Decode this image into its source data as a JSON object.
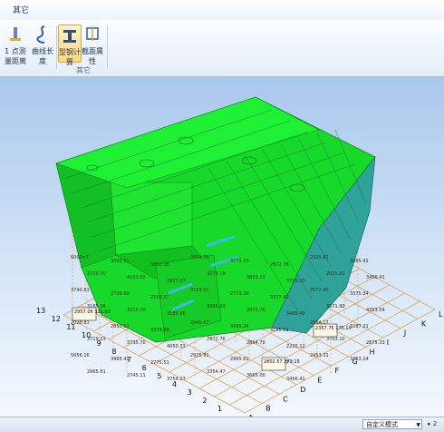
{
  "menubar": {
    "items": [
      "其它"
    ]
  },
  "ribbon": {
    "buttons": [
      {
        "label": "1 点测量距离",
        "icon": "measure-icon"
      },
      {
        "label": "曲线长度",
        "icon": "curve-length-icon"
      },
      {
        "label": "型钢计算",
        "icon": "profile-calc-icon",
        "active": true
      },
      {
        "label": "截面属性",
        "icon": "section-property-icon"
      }
    ],
    "group_label": "其它"
  },
  "viewport": {
    "grid_numbers": [
      "13",
      "12",
      "11",
      "10",
      "9",
      "8",
      "7",
      "6",
      "5",
      "4",
      "3",
      "2",
      "1"
    ],
    "grid_letters": [
      "A",
      "B",
      "C",
      "D",
      "E",
      "F",
      "G",
      "H",
      "I",
      "J",
      "K",
      "L"
    ],
    "dimension_labels": [
      "6090×7",
      "3095.51",
      "3850.28",
      "2972.76",
      "3771.23",
      "2972.76",
      "2025.81",
      "3465.41",
      "3725.70",
      "4153.51",
      "2857.07",
      "3279.19",
      "3819.23",
      "3719.23",
      "2025.81",
      "3456.41",
      "3740.61",
      "2720.69",
      "2150.57",
      "4153.51",
      "2772.30",
      "3377.45",
      "2572.40",
      "3375.34",
      "3185.56",
      "3215.70",
      "3185.56",
      "3365.24",
      "2972.76",
      "3465.40",
      "3571.90",
      "4353.54",
      "2025.81",
      "2850.57",
      "3378.89",
      "2940.67",
      "3455.24",
      "3195.51",
      "2954.17",
      "3287.21",
      "3719.23",
      "3735.70",
      "4050.33",
      "2972.76",
      "2854.70",
      "2225.12",
      "3703.10",
      "2875.33",
      "5656.16",
      "3465.41",
      "2775.51",
      "2925.81",
      "2965.61",
      "3895.97",
      "2453.31",
      "3753.24",
      "2965.61",
      "2745.11",
      "3754.27",
      "3354.47",
      "3665.00",
      "3456.41"
    ],
    "callouts": [
      "2957.06\n311.02",
      "2357.75\n175.10",
      "2802.57\n279.15"
    ]
  },
  "statusbar": {
    "mode_select": "自定义模式",
    "tail": "▸ 2"
  },
  "colors": {
    "hull_green": "#16d92a",
    "hull_teal": "#2fa39a",
    "grid_line": "#d98c2a",
    "beam_blue": "#3fb7e8",
    "background_top": "#a9c8ec"
  }
}
